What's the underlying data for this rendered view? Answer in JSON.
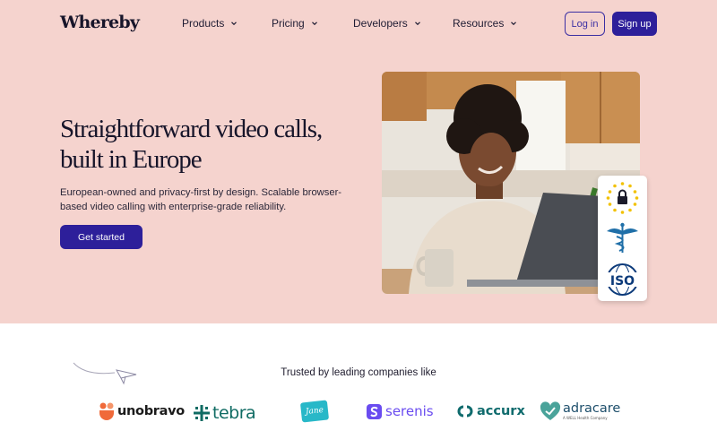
{
  "header": {
    "logo": "Whereby",
    "nav": [
      {
        "label": "Products"
      },
      {
        "label": "Pricing"
      },
      {
        "label": "Developers"
      },
      {
        "label": "Resources"
      }
    ],
    "login_label": "Log in",
    "signup_label": "Sign up"
  },
  "hero": {
    "headline": "Straightforward video calls, built in Europe",
    "subtext": "European-owned and privacy-first by design. Scalable browser-based video calling with enterprise-grade reliability.",
    "cta_label": "Get started",
    "badges": [
      "gdpr-lock-icon",
      "caduceus-icon",
      "iso-icon"
    ],
    "iso_text": "ISO"
  },
  "trusted": {
    "label": "Trusted by leading companies like",
    "logos": [
      {
        "name": "unobravo",
        "color": "#f06a3a"
      },
      {
        "name": "tebra",
        "color": "#0f6b63"
      },
      {
        "name": "Jane",
        "color": "#28b8c8"
      },
      {
        "name": "serenis",
        "color": "#6a4cf0"
      },
      {
        "name": "accurx",
        "color": "#0f6b6d"
      },
      {
        "name": "adracare",
        "sub": "A WELL Health Company",
        "color": "#4aa39a"
      }
    ]
  },
  "colors": {
    "hero_bg": "#f5d3ce",
    "primary": "#2d1f9a",
    "text": "#17152a"
  }
}
